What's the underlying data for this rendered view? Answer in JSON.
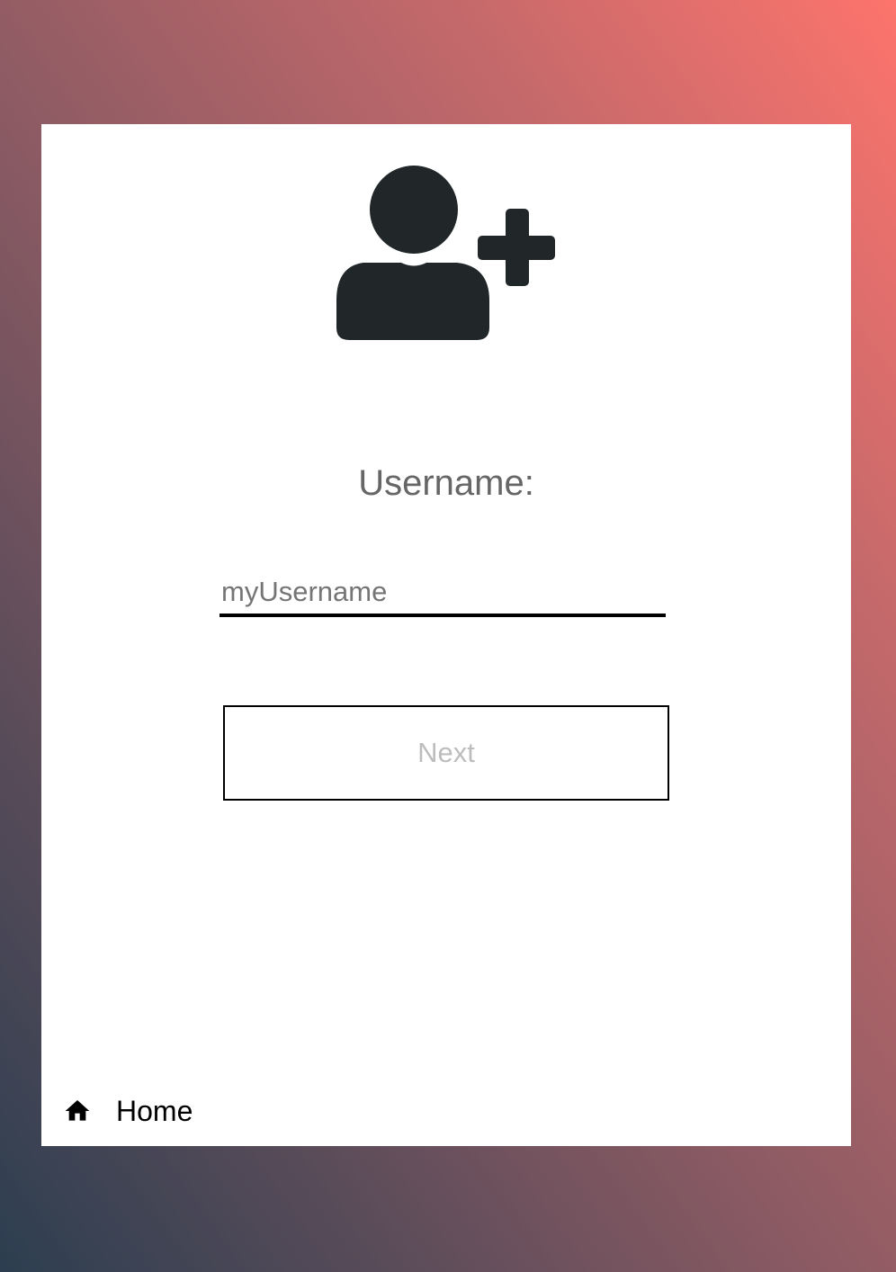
{
  "form": {
    "icon": "add-user-icon",
    "username_label": "Username:",
    "username_value": "",
    "username_placeholder": "myUsername",
    "next_label": "Next"
  },
  "footer": {
    "home_icon": "home-icon",
    "home_label": "Home"
  },
  "colors": {
    "gradient_start": "#2c3e50",
    "gradient_end": "#fd746c",
    "icon_color": "#212729",
    "label_color": "#666666",
    "button_text_color": "#bdbdbd"
  }
}
